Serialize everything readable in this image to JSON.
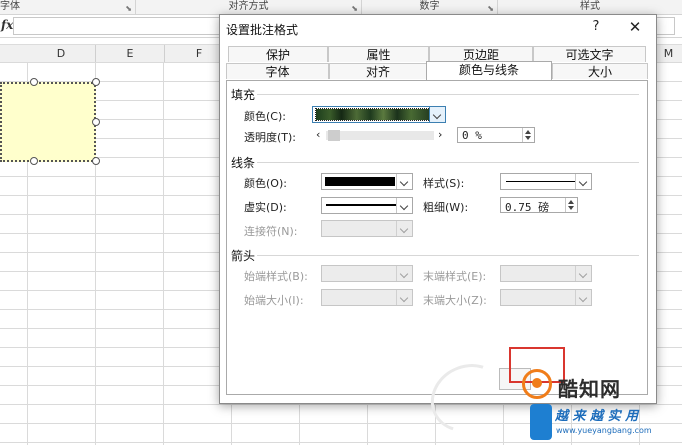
{
  "excel": {
    "ribbon_groups": [
      "字体",
      "对齐方式",
      "数字",
      "样式"
    ],
    "fx_symbol": "fx",
    "column_headers": [
      "D",
      "E",
      "F",
      "M"
    ]
  },
  "dialog": {
    "title": "设置批注格式",
    "help_label": "?",
    "close_label": "✕",
    "tabs_row1": [
      "保护",
      "属性",
      "页边距",
      "可选文字"
    ],
    "tabs_row2": [
      "字体",
      "对齐",
      "颜色与线条",
      "大小"
    ],
    "active_tab": "颜色与线条",
    "fill": {
      "section_title": "填充",
      "color_label": "颜色(C):",
      "color_value": "grass texture",
      "transparency_label": "透明度(T):",
      "transparency_value": "0 %",
      "transparency_fraction": 0.0
    },
    "line": {
      "section_title": "线条",
      "color_label": "颜色(O):",
      "color_value": "#000000",
      "style_label": "样式(S):",
      "dashed_label": "虚实(D):",
      "weight_label": "粗细(W):",
      "weight_value": "0.75 磅",
      "connector_label": "连接符(N):"
    },
    "arrows": {
      "section_title": "箭头",
      "begin_style_label": "始端样式(B):",
      "end_style_label": "末端样式(E):",
      "begin_size_label": "始端大小(I):",
      "end_size_label": "末端大小(Z):"
    }
  },
  "watermark": {
    "name": "酷知网",
    "tagline": "越 来 越 实 用",
    "url": "www.yueyangbang.com"
  },
  "colors": {
    "accent_border": "#3c7fb1",
    "red_highlight": "#d9362f",
    "comment_fill": "#ffffcc",
    "logo_orange": "#f07d1a",
    "watermark_blue": "#1e6dbb"
  }
}
